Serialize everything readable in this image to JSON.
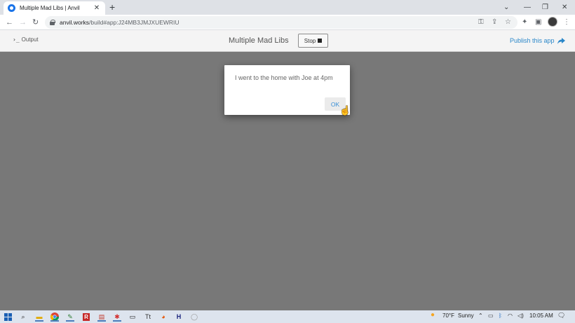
{
  "browser": {
    "tab_title": "Multiple Mad Libs | Anvil",
    "tab_close": "✕",
    "new_tab": "+",
    "url_host": "anvil.works",
    "url_path": "/build#app:J24MB3JMJXUEWRIU",
    "minimize": "—",
    "restore": "❐",
    "close": "✕",
    "dropdown": "⌄"
  },
  "app_header": {
    "output_prompt": "›_",
    "output_label": "Output",
    "title": "Multiple Mad Libs",
    "stop_label": "Stop",
    "publish_label": "Publish this app"
  },
  "dialog": {
    "message": "I went to the home with Joe at 4pm",
    "ok_label": "OK"
  },
  "taskbar": {
    "weather_temp": "70°F",
    "weather_desc": "Sunny",
    "time": "10:05 AM"
  },
  "colors": {
    "accent": "#2a87c9",
    "app_background": "#787878",
    "taskbar": "#dde4ee"
  }
}
